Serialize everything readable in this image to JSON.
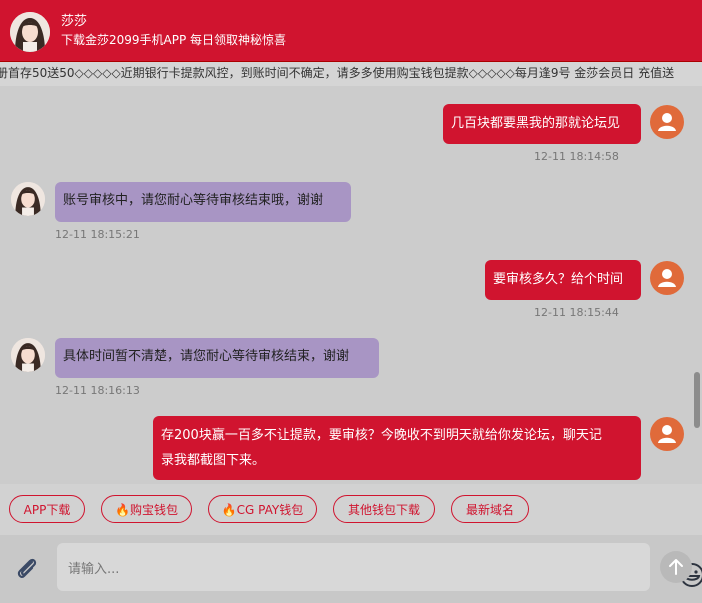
{
  "header": {
    "name": "莎莎",
    "subtitle": "下载金莎2099手机APP 每日领取神秘惊喜"
  },
  "marquee": {
    "text": "册首存50送50◇◇◇◇◇近期银行卡提款风控，到账时间不确定，请多多使用购宝钱包提款◇◇◇◇◇每月逢9号 金莎会员日 充值送"
  },
  "messages": [
    {
      "side": "right",
      "text": "几百块都要黑我的那就论坛见",
      "time": "12-11 18:14:58"
    },
    {
      "side": "left",
      "text": "账号审核中，请您耐心等待审核结束哦，谢谢",
      "time": "12-11 18:15:21"
    },
    {
      "side": "right",
      "text": "要审核多久？给个时间",
      "time": "12-11 18:15:44"
    },
    {
      "side": "left",
      "text": "具体时间暂不清楚，请您耐心等待审核结束，谢谢",
      "time": "12-11 18:16:13"
    },
    {
      "side": "right",
      "text_line1": "存200块赢一百多不让提款，要审核？今晚收不到明天就给你发论坛，聊天记",
      "text_line2": "录我都截图下来。"
    }
  ],
  "quick_buttons": [
    "APP下载",
    "🔥购宝钱包",
    "🔥CG PAY钱包",
    "其他钱包下载",
    "最新域名"
  ],
  "input": {
    "placeholder": "请输入..."
  },
  "colors": {
    "brand_red": "#d0142f",
    "agent_bubble": "#a895c4",
    "user_avatar": "#e06a3a"
  }
}
